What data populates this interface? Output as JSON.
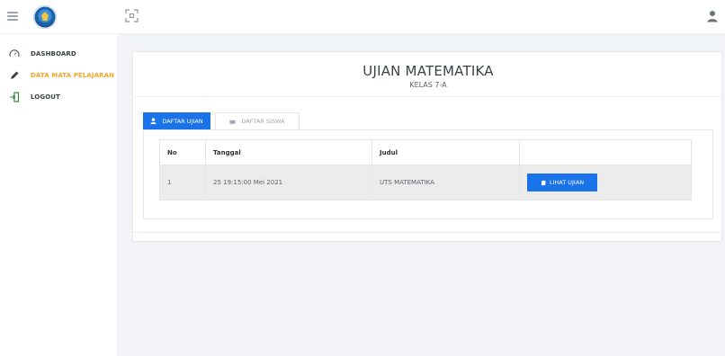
{
  "sidebar": {
    "items": [
      {
        "label": "DASHBOARD",
        "icon": "speedometer-icon",
        "active": false
      },
      {
        "label": "DATA MATA PELAJARAN",
        "icon": "pencil-icon",
        "active": true
      },
      {
        "label": "LOGOUT",
        "icon": "logout-icon",
        "active": false
      }
    ]
  },
  "header": {
    "logo": "tut-wuri-handayani-logo",
    "icons": [
      "menu-icon",
      "fullscreen-icon",
      "user-icon"
    ]
  },
  "main": {
    "title": "UJIAN MATEMATIKA",
    "subtitle": "KELAS 7-A",
    "tabs": [
      {
        "label": "DAFTAR UJIAN",
        "icon": "user-icon",
        "active": true
      },
      {
        "label": "DAFTAR SISWA",
        "icon": "id-card-icon",
        "active": false
      }
    ],
    "table": {
      "headers": [
        "No",
        "Tanggal",
        "Judul",
        ""
      ],
      "rows": [
        {
          "no": "1",
          "tanggal": "25 19:15:00 Mei 2021",
          "judul": "UTS MATEMATIKA",
          "action_label": "LIHAT UJIAN"
        }
      ]
    }
  },
  "colors": {
    "accent": "#1a73e8",
    "active_nav": "#f5a623",
    "background": "#f1f3f7"
  }
}
